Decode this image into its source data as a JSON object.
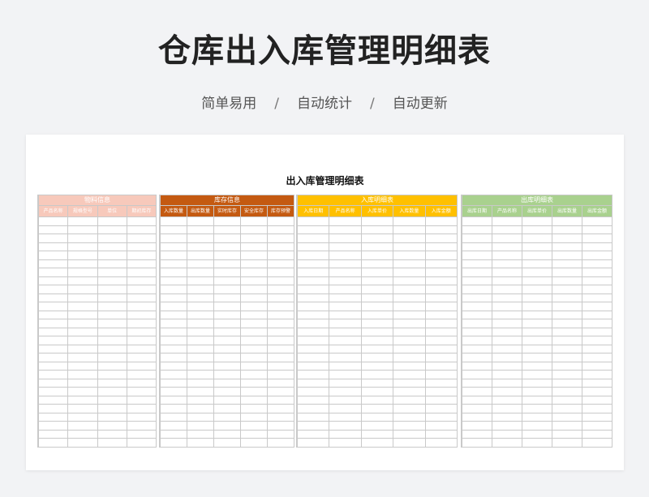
{
  "header": {
    "title": "仓库出入库管理明细表",
    "subtitle": [
      "简单易用",
      "自动统计",
      "自动更新"
    ],
    "separator": "/"
  },
  "sheet": {
    "title": "出入库管理明细表",
    "blocks": [
      {
        "title": "物料信息",
        "color": "#f7c9bb",
        "columns": [
          "产品名称",
          "规格型号",
          "单位",
          "期初库存"
        ]
      },
      {
        "title": "库存信息",
        "color": "#c45a11",
        "columns": [
          "入库数量",
          "出库数量",
          "实时库存",
          "安全库存",
          "库存预警"
        ]
      },
      {
        "title": "入库明细表",
        "color": "#ffc000",
        "columns": [
          "入库日期",
          "产品名称",
          "入库单价",
          "入库数量",
          "入库金额"
        ]
      },
      {
        "title": "出库明细表",
        "color": "#a9d18e",
        "columns": [
          "出库日期",
          "产品名称",
          "出库单价",
          "出库数量",
          "出库金额"
        ]
      }
    ]
  }
}
